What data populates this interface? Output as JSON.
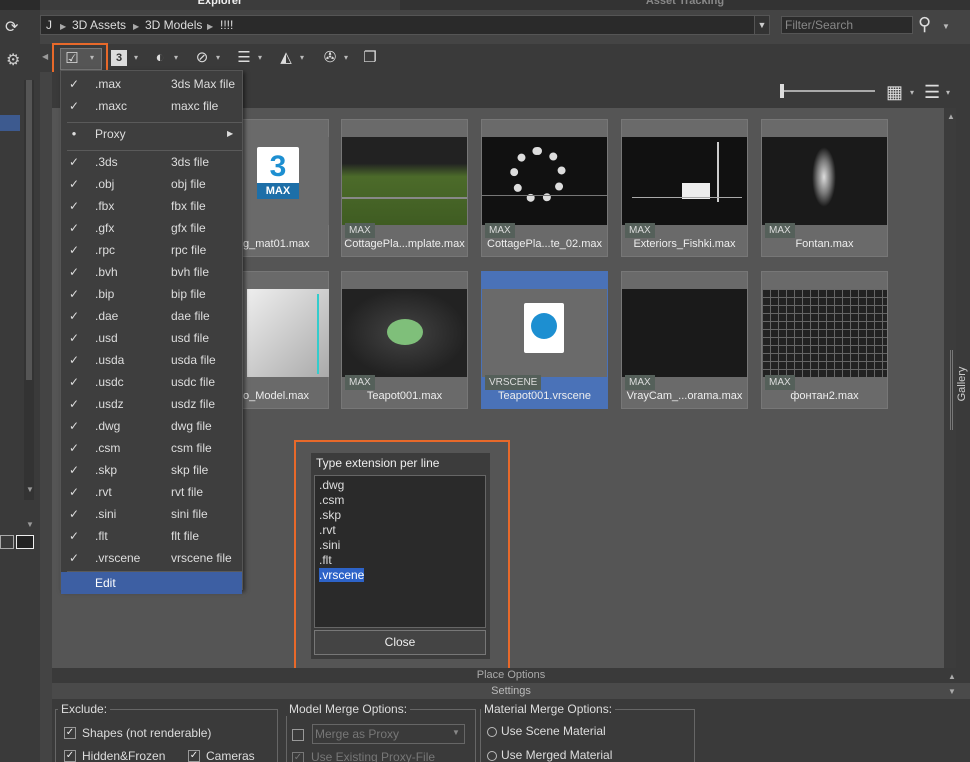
{
  "tabs": {
    "explorer": "Explorer",
    "asset_tracking": "Asset Tracking"
  },
  "breadcrumb": [
    "J",
    "3D Assets",
    "3D Models",
    "!!!!"
  ],
  "filter_placeholder": "Filter/Search",
  "menu_items": [
    {
      "checked": true,
      "ext": ".max",
      "desc": "3ds Max file"
    },
    {
      "checked": true,
      "ext": ".maxc",
      "desc": "maxc file"
    },
    {
      "bullet": true,
      "ext": "Proxy",
      "desc": "",
      "submenu": true
    },
    {
      "checked": true,
      "ext": ".3ds",
      "desc": "3ds file"
    },
    {
      "checked": true,
      "ext": ".obj",
      "desc": "obj file"
    },
    {
      "checked": true,
      "ext": ".fbx",
      "desc": "fbx file"
    },
    {
      "checked": true,
      "ext": ".gfx",
      "desc": "gfx file"
    },
    {
      "checked": true,
      "ext": ".rpc",
      "desc": "rpc file"
    },
    {
      "checked": true,
      "ext": ".bvh",
      "desc": "bvh file"
    },
    {
      "checked": true,
      "ext": ".bip",
      "desc": "bip file"
    },
    {
      "checked": true,
      "ext": ".dae",
      "desc": "dae file"
    },
    {
      "checked": true,
      "ext": ".usd",
      "desc": "usd file"
    },
    {
      "checked": true,
      "ext": ".usda",
      "desc": "usda file"
    },
    {
      "checked": true,
      "ext": ".usdc",
      "desc": "usdc file"
    },
    {
      "checked": true,
      "ext": ".usdz",
      "desc": "usdz file"
    },
    {
      "checked": true,
      "ext": ".dwg",
      "desc": "dwg file"
    },
    {
      "checked": true,
      "ext": ".csm",
      "desc": "csm file"
    },
    {
      "checked": true,
      "ext": ".skp",
      "desc": "skp file"
    },
    {
      "checked": true,
      "ext": ".rvt",
      "desc": "rvt file"
    },
    {
      "checked": true,
      "ext": ".sini",
      "desc": "sini file"
    },
    {
      "checked": true,
      "ext": ".flt",
      "desc": "flt file"
    },
    {
      "checked": true,
      "ext": ".vrscene",
      "desc": "vrscene file"
    },
    {
      "checked": false,
      "ext": "Edit",
      "desc": "",
      "active": true
    }
  ],
  "thumbnails": [
    {
      "label": "g_mat01.max",
      "badge": "",
      "kind": "maxicon"
    },
    {
      "label": "CottagePla...mplate.max",
      "badge": "MAX",
      "kind": "grass"
    },
    {
      "label": "CottagePla...te_02.max",
      "badge": "MAX",
      "kind": "ring"
    },
    {
      "label": "Exteriors_Fishki.max",
      "badge": "MAX",
      "kind": "street"
    },
    {
      "label": "Fontan.max",
      "badge": "MAX",
      "kind": "fountain"
    },
    {
      "label": "o_Model.max",
      "badge": "",
      "kind": "white"
    },
    {
      "label": "Teapot001.max",
      "badge": "MAX",
      "kind": "teapot"
    },
    {
      "label": "Teapot001.vrscene",
      "badge": "VRSCENE",
      "kind": "vrscene",
      "selected": true
    },
    {
      "label": "VrayCam_...orama.max",
      "badge": "MAX",
      "kind": "dark"
    },
    {
      "label": "фонтан2.max",
      "badge": "MAX",
      "kind": "grid"
    }
  ],
  "max_icon_text": {
    "digit": "3",
    "word": "MAX"
  },
  "dialog": {
    "title": "Type extension per line",
    "lines": [
      ".dwg",
      ".csm",
      ".skp",
      ".rvt",
      ".sini",
      ".flt",
      ".vrscene"
    ],
    "close": "Close"
  },
  "bottom": {
    "place_options": "Place Options",
    "settings": "Settings",
    "exclude_title": "Exclude:",
    "shapes": "Shapes (not renderable)",
    "hidden_frozen": "Hidden&Frozen",
    "cameras": "Cameras",
    "model_merge_title": "Model Merge Options:",
    "merge_as_proxy": "Merge as Proxy",
    "use_existing_proxy": "Use Existing Proxy-File",
    "material_merge_title": "Material Merge Options:",
    "use_scene_material": "Use Scene Material",
    "use_merged_material": "Use Merged Material"
  },
  "gallery_label": "Gallery"
}
